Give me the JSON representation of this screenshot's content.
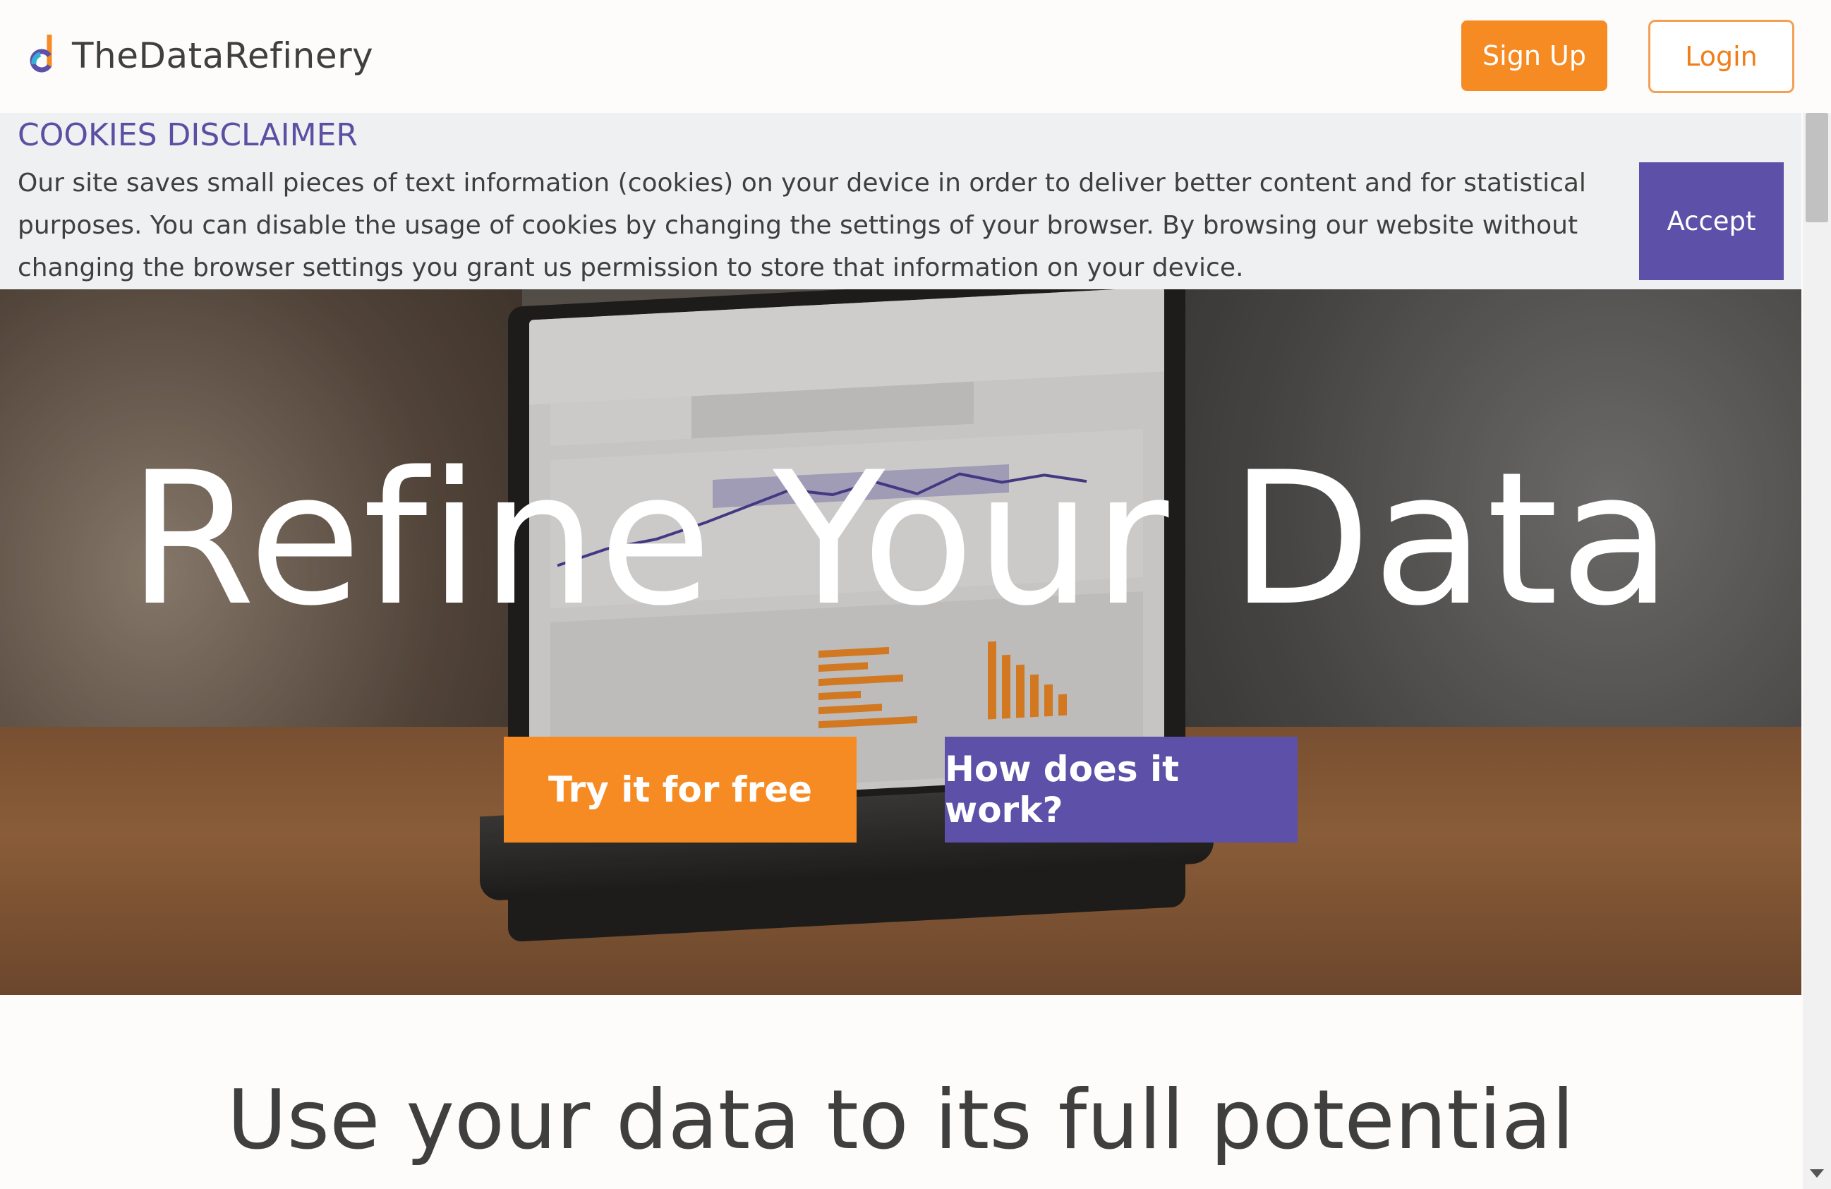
{
  "header": {
    "brand": "TheDataRefinery",
    "signup_label": "Sign Up",
    "login_label": "Login",
    "colors": {
      "orange": "#f78b23",
      "purple": "#5d50a8"
    }
  },
  "cookie": {
    "title": "COOKIES DISCLAIMER",
    "text": "Our site saves small pieces of text information (cookies) on your device in order to deliver better content and for statistical purposes. You can disable the usage of cookies by changing the settings of your browser. By browsing our website without changing the browser settings you grant us permission to store that information on your device.",
    "accept_label": "Accept"
  },
  "hero": {
    "title": "Refine Your Data",
    "try_label": "Try it for free",
    "how_label": "How does it work?"
  },
  "section": {
    "title": "Use your data to its full potential"
  },
  "icons": [
    "logo-icon",
    "scroll-down-arrow-icon"
  ]
}
